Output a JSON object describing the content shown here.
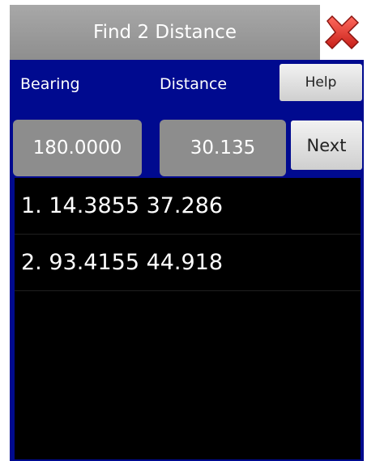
{
  "app": {
    "title": "Find 2 Distance"
  },
  "header": {
    "close_icon": "close-x-icon",
    "close_color": "#e53a2e"
  },
  "labels": {
    "bearing": "Bearing",
    "distance": "Distance"
  },
  "buttons": {
    "help": "Help",
    "next": "Next"
  },
  "inputs": {
    "bearing_value": "180.0000",
    "distance_value": "30.135"
  },
  "results": [
    {
      "text": "1. 14.3855 37.286"
    },
    {
      "text": "2. 93.4155 44.918"
    }
  ],
  "colors": {
    "background": "#000a8f",
    "title_bar": "#9b9b9b",
    "field": "#8d8d8d",
    "list_background": "#000000"
  }
}
